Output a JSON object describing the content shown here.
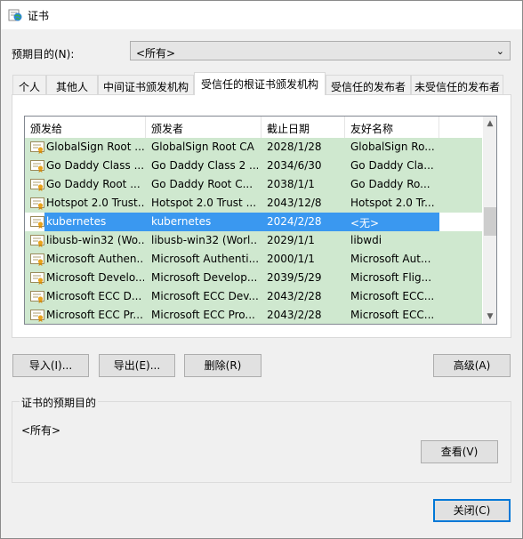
{
  "window": {
    "title": "证书"
  },
  "purpose": {
    "label": "预期目的(N):",
    "value": "<所有>"
  },
  "tabs": [
    {
      "label": "个人"
    },
    {
      "label": "其他人"
    },
    {
      "label": "中间证书颁发机构"
    },
    {
      "label": "受信任的根证书颁发机构",
      "active": true
    },
    {
      "label": "受信任的发布者"
    },
    {
      "label": "未受信任的发布者"
    }
  ],
  "list": {
    "headers": [
      "颁发给",
      "颁发者",
      "截止日期",
      "友好名称"
    ],
    "rows": [
      {
        "issued_to": "GlobalSign Root ...",
        "issued_by": "GlobalSign Root CA",
        "expires": "2028/1/28",
        "friendly": "GlobalSign Ro..."
      },
      {
        "issued_to": "Go Daddy Class ...",
        "issued_by": "Go Daddy Class 2 ...",
        "expires": "2034/6/30",
        "friendly": "Go Daddy Cla..."
      },
      {
        "issued_to": "Go Daddy Root ...",
        "issued_by": "Go Daddy Root C...",
        "expires": "2038/1/1",
        "friendly": "Go Daddy Ro..."
      },
      {
        "issued_to": "Hotspot 2.0 Trust...",
        "issued_by": "Hotspot 2.0 Trust ...",
        "expires": "2043/12/8",
        "friendly": "Hotspot 2.0 Tr..."
      },
      {
        "issued_to": "kubernetes",
        "issued_by": "kubernetes",
        "expires": "2024/2/28",
        "friendly": "<无>",
        "selected": true
      },
      {
        "issued_to": "libusb-win32 (Wo...",
        "issued_by": "libusb-win32 (Worl...",
        "expires": "2029/1/1",
        "friendly": "libwdi"
      },
      {
        "issued_to": "Microsoft Authen...",
        "issued_by": "Microsoft Authenti...",
        "expires": "2000/1/1",
        "friendly": "Microsoft Aut..."
      },
      {
        "issued_to": "Microsoft Develo...",
        "issued_by": "Microsoft Develop...",
        "expires": "2039/5/29",
        "friendly": "Microsoft Flig..."
      },
      {
        "issued_to": "Microsoft ECC D...",
        "issued_by": "Microsoft ECC Dev...",
        "expires": "2043/2/28",
        "friendly": "Microsoft ECC..."
      },
      {
        "issued_to": "Microsoft ECC Pr...",
        "issued_by": "Microsoft ECC Pro...",
        "expires": "2043/2/28",
        "friendly": "Microsoft ECC..."
      }
    ]
  },
  "buttons": {
    "import": "导入(I)...",
    "export": "导出(E)...",
    "remove": "删除(R)",
    "advanced": "高级(A)",
    "view": "查看(V)",
    "close": "关闭(C)"
  },
  "purpose_group": {
    "title": "证书的预期目的",
    "value": "<所有>"
  },
  "colors": {
    "trusted_row": "#cfe8cf",
    "selected_row": "#3a98f0",
    "default_button_border": "#0078d7"
  },
  "icons": {
    "title": "certificate-globe-icon",
    "row": "certificate-icon",
    "combo": "chevron-down-icon"
  }
}
